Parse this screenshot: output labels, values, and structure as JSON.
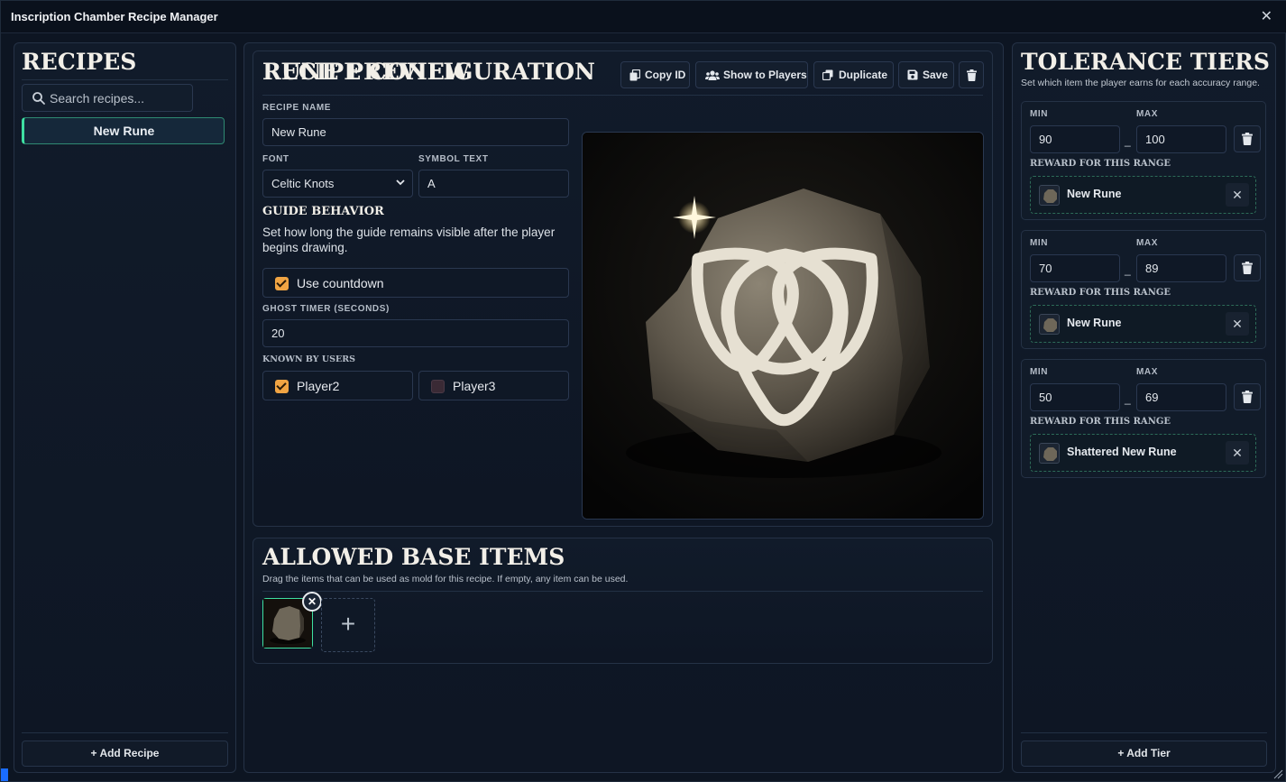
{
  "window": {
    "title": "Inscription Chamber Recipe Manager"
  },
  "sidebar": {
    "heading": "RECIPES",
    "search_placeholder": "Search recipes...",
    "items": [
      {
        "label": "New Rune",
        "selected": true
      }
    ],
    "add_label": "Add Recipe"
  },
  "config": {
    "heading": "RECIPE CONFIGURATION",
    "toolbar": {
      "copy_id": "Copy ID",
      "show_players": "Show to Players",
      "duplicate": "Duplicate",
      "save": "Save"
    },
    "name_label": "RECIPE NAME",
    "name_value": "New Rune",
    "font_label": "FONT",
    "font_value": "Celtic Knots",
    "symbol_label": "SYMBOL TEXT",
    "symbol_value": "A",
    "guide_heading": "GUIDE BEHAVIOR",
    "guide_desc": "Set how long the guide remains visible after the player begins drawing.",
    "countdown_label": "Use countdown",
    "countdown_checked": true,
    "ghost_label": "GHOST TIMER (SECONDS)",
    "ghost_value": "20",
    "known_label": "KNOWN BY USERS",
    "users": [
      {
        "name": "Player2",
        "checked": true
      },
      {
        "name": "Player3",
        "checked": false
      }
    ],
    "preview_heading": "RUNE PREVIEW"
  },
  "allowed": {
    "heading": "ALLOWED BASE ITEMS",
    "description": "Drag the items that can be used as mold for this recipe. If empty, any item can be used.",
    "add_symbol": "+",
    "remove_symbol": "✕"
  },
  "tiers": {
    "heading": "TOLERANCE TIERS",
    "description": "Set which item the player earns for each accuracy range.",
    "min_label": "MIN",
    "max_label": "MAX",
    "reward_label": "REWARD FOR THIS RANGE",
    "separator": "_",
    "items": [
      {
        "min": "90",
        "max": "100",
        "reward": "New Rune"
      },
      {
        "min": "70",
        "max": "89",
        "reward": "New Rune"
      },
      {
        "min": "50",
        "max": "69",
        "reward": "Shattered New Rune"
      }
    ],
    "add_label": "Add Tier"
  },
  "colors": {
    "accent_green": "#3ee0a2",
    "checkbox_orange": "#f0a443",
    "background": "#0d1522"
  }
}
